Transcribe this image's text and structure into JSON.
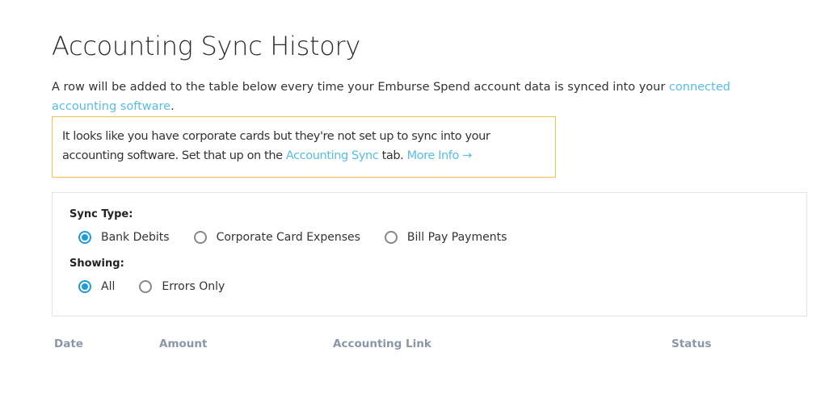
{
  "page": {
    "title": "Accounting Sync History"
  },
  "intro": {
    "text": "A row will be added to the table below every time your Emburse Spend account data is synced into your ",
    "link": "connected accounting software",
    "suffix": "."
  },
  "notice": {
    "text": "It looks like you have corporate cards but they're not set up to sync into your accounting software. Set that up on the ",
    "link1": "Accounting Sync",
    "middle": " tab. ",
    "link2": "More Info →",
    "border_color": "#f2c24f"
  },
  "filters": {
    "sync_type": {
      "label": "Sync Type:",
      "options": [
        {
          "label": "Bank Debits",
          "checked": true
        },
        {
          "label": "Corporate Card Expenses",
          "checked": false
        },
        {
          "label": "Bill Pay Payments",
          "checked": false
        }
      ]
    },
    "showing": {
      "label": "Showing:",
      "options": [
        {
          "label": "All",
          "checked": true
        },
        {
          "label": "Errors Only",
          "checked": false
        }
      ]
    }
  },
  "table": {
    "columns": [
      "Date",
      "Amount",
      "Accounting Link",
      "Status"
    ],
    "rows": []
  },
  "colors": {
    "accent": "#1e9ad6",
    "link": "#56bde8",
    "header_text": "#8a97a8"
  }
}
